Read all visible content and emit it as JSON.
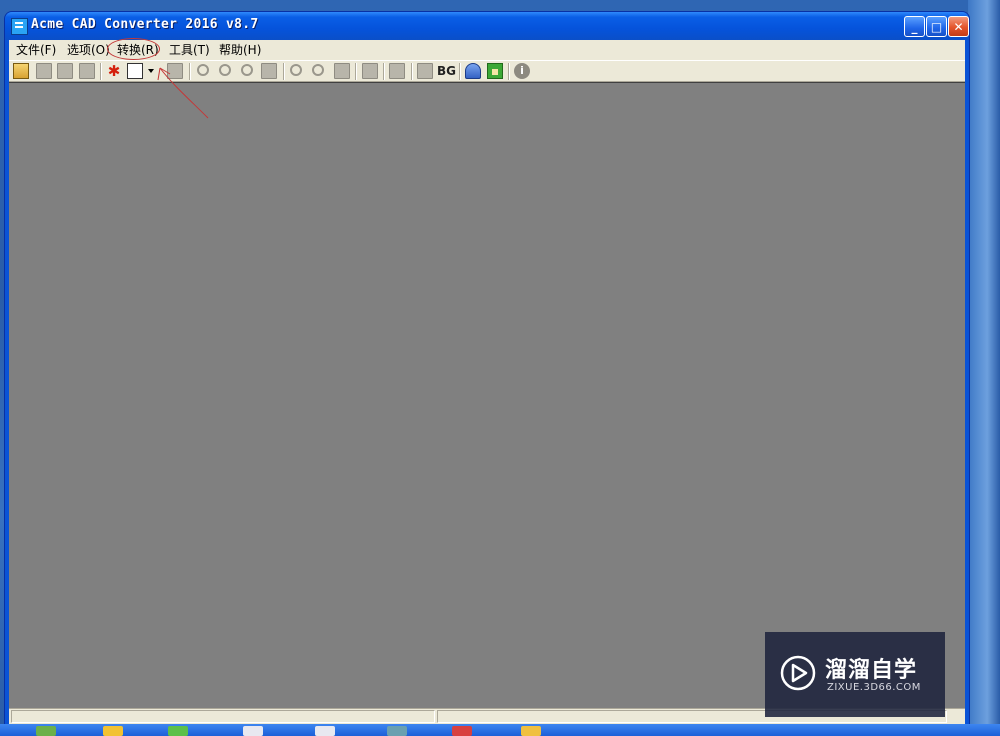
{
  "window": {
    "title": "Acme CAD Converter 2016 v8.7",
    "controls": {
      "minimize": "_",
      "maximize": "□",
      "close": "✕"
    }
  },
  "menu": [
    {
      "label": "文件(F)"
    },
    {
      "label": "选项(O)"
    },
    {
      "label": "转换(R)"
    },
    {
      "label": "工具(T)"
    },
    {
      "label": "帮助(H)"
    }
  ],
  "annotation": {
    "highlighted_menu": "转换(R)",
    "color": "#c43838"
  },
  "toolbar": {
    "icons": [
      "open-icon",
      "save-icon",
      "save-all-icon",
      "batch-icon",
      "pdf-icon",
      "convert-icon",
      "print-icon",
      "zoom-out-icon",
      "zoom-in-icon",
      "zoom-fit-icon",
      "zoom-window-icon",
      "zoom-realtime-icon",
      "pan-icon",
      "orbit-icon",
      "layer-icon",
      "bw-icon",
      "layers-icon",
      "background-icon",
      "measure-icon",
      "home-icon",
      "about-icon"
    ],
    "bg_label": "BG",
    "acrobat_glyph": "✱",
    "info_glyph": "i"
  },
  "watermark": {
    "title": "溜溜自学",
    "subtitle": "ZIXUE.3D66.COM"
  },
  "colors": {
    "titlebar": "#0553db",
    "workspace": "#808080",
    "chrome": "#ece9d8",
    "desktop": "#2f66b3"
  }
}
